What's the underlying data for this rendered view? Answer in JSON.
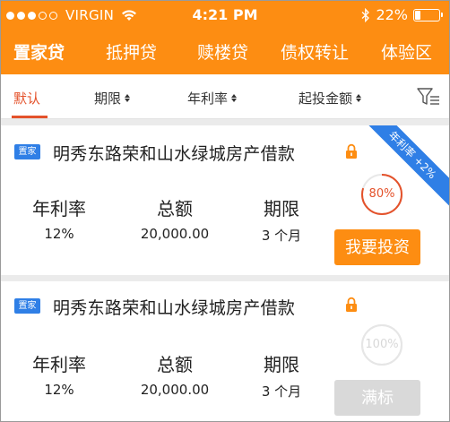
{
  "status_bar": {
    "carrier": "VIRGIN",
    "time": "4:21 PM",
    "battery": "22%",
    "battery_level": 0.22
  },
  "top_tabs": [
    {
      "label": "置家贷",
      "active": true
    },
    {
      "label": "抵押贷",
      "active": false
    },
    {
      "label": "赎楼贷",
      "active": false
    },
    {
      "label": "债权转让",
      "active": false
    },
    {
      "label": "体验区",
      "active": false
    }
  ],
  "filters": {
    "default": "默认",
    "term": "期限",
    "rate": "年利率",
    "min_invest": "起投金额"
  },
  "products": [
    {
      "tag": "置家",
      "title": "明秀东路荣和山水绿城房产借款",
      "rate_label": "年利率",
      "rate": "12%",
      "amount_label": "总额",
      "amount": "20,000.00",
      "term_label": "期限",
      "term": "3 个月",
      "progress_text": "80%",
      "progress": 0.8,
      "button": "我要投资",
      "ribbon": "年利率 +2%"
    },
    {
      "tag": "置家",
      "title": "明秀东路荣和山水绿城房产借款",
      "rate_label": "年利率",
      "rate": "12%",
      "amount_label": "总额",
      "amount": "20,000.00",
      "term_label": "期限",
      "term": "3 个月",
      "progress_text": "100%",
      "progress": 1.0,
      "button": "满标"
    }
  ],
  "colors": {
    "brand_orange": "#fd8d12",
    "active_red": "#e4522b",
    "tag_blue": "#2f7fe6",
    "disabled_gray": "#d9d9d9"
  }
}
